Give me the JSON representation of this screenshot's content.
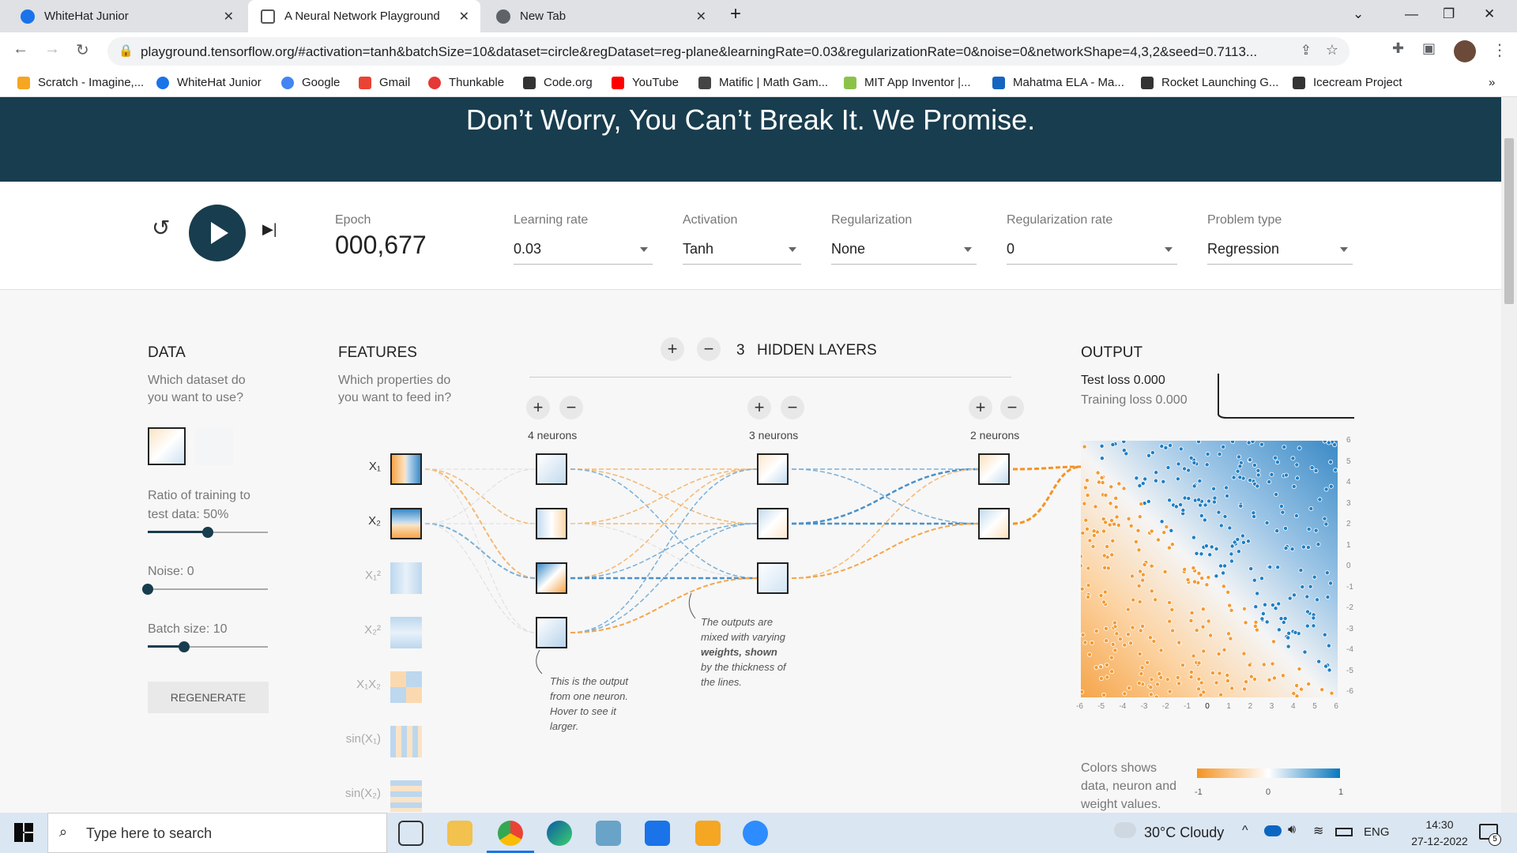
{
  "browser": {
    "tabs": [
      {
        "label": "WhiteHat Junior",
        "active": false
      },
      {
        "label": "A Neural Network Playground",
        "active": true
      },
      {
        "label": "New Tab",
        "active": false
      }
    ],
    "url": "playground.tensorflow.org/#activation=tanh&batchSize=10&dataset=circle&regDataset=reg-plane&learningRate=0.03&regularizationRate=0&noise=0&networkShape=4,3,2&seed=0.7113...",
    "bookmarks": [
      "Scratch - Imagine,...",
      "WhiteHat Junior",
      "Google",
      "Gmail",
      "Thunkable",
      "Code.org",
      "YouTube",
      "Matific | Math Gam...",
      "MIT App Inventor |...",
      "Mahatma ELA - Ma...",
      "Rocket Launching G...",
      "Icecream Project"
    ],
    "more": "»"
  },
  "hero": {
    "text": "Don’t Worry, You Can’t Break It. We Promise."
  },
  "controls": {
    "epoch_label": "Epoch",
    "epoch_value": "000,677",
    "learning_rate_label": "Learning rate",
    "learning_rate_value": "0.03",
    "activation_label": "Activation",
    "activation_value": "Tanh",
    "regularization_label": "Regularization",
    "regularization_value": "None",
    "reg_rate_label": "Regularization rate",
    "reg_rate_value": "0",
    "problem_label": "Problem type",
    "problem_value": "Regression"
  },
  "data_panel": {
    "title": "DATA",
    "subtitle_1": "Which dataset do",
    "subtitle_2": "you want to use?",
    "ratio_label_1": "Ratio of training to",
    "ratio_label_2": "test data:  50%",
    "ratio_value": 0.5,
    "noise_label": "Noise:  0",
    "noise_value": 0,
    "batch_label": "Batch size:  10",
    "batch_value": 0.3,
    "regenerate": "REGENERATE"
  },
  "features_panel": {
    "title": "FEATURES",
    "subtitle_1": "Which properties do",
    "subtitle_2": "you want to feed in?",
    "features": [
      {
        "label": "X₁",
        "active": true
      },
      {
        "label": "X₂",
        "active": true
      },
      {
        "label": "X₁²",
        "active": false
      },
      {
        "label": "X₂²",
        "active": false
      },
      {
        "label": "X₁X₂",
        "active": false
      },
      {
        "label": "sin(X₁)",
        "active": false
      },
      {
        "label": "sin(X₂)",
        "active": false
      }
    ]
  },
  "network": {
    "hidden_layers_count": "3",
    "hidden_layers_label": "HIDDEN LAYERS",
    "layers": [
      {
        "label": "4 neurons"
      },
      {
        "label": "3 neurons"
      },
      {
        "label": "2 neurons"
      }
    ],
    "annotation_neuron": [
      "This is the output",
      "from one neuron.",
      "Hover to see it",
      "larger."
    ],
    "annotation_weights": [
      "The outputs are",
      "mixed with varying",
      "weights, shown",
      "by the thickness of",
      "the lines."
    ]
  },
  "output_panel": {
    "title": "OUTPUT",
    "test_loss": "Test loss 0.000",
    "training_loss": "Training loss 0.000",
    "y_ticks": [
      "6",
      "5",
      "4",
      "3",
      "2",
      "1",
      "0",
      "-1",
      "-2",
      "-3",
      "-4",
      "-5",
      "-6"
    ],
    "x_ticks": [
      "-6",
      "-5",
      "-4",
      "-3",
      "-2",
      "-1",
      "0",
      "1",
      "2",
      "3",
      "4",
      "5",
      "6"
    ],
    "legend_text_1": "Colors shows",
    "legend_text_2": "data, neuron and",
    "legend_text_3": "weight values.",
    "legend_min": "-1",
    "legend_mid": "0",
    "legend_max": "1",
    "colors": {
      "negative": "#f59322",
      "positive": "#0877bd",
      "hero": "#183d4e"
    }
  },
  "taskbar": {
    "search_placeholder": "Type here to search",
    "weather": "30°C  Cloudy",
    "lang": "ENG",
    "time": "14:30",
    "date": "27-12-2022",
    "notif": "5"
  }
}
